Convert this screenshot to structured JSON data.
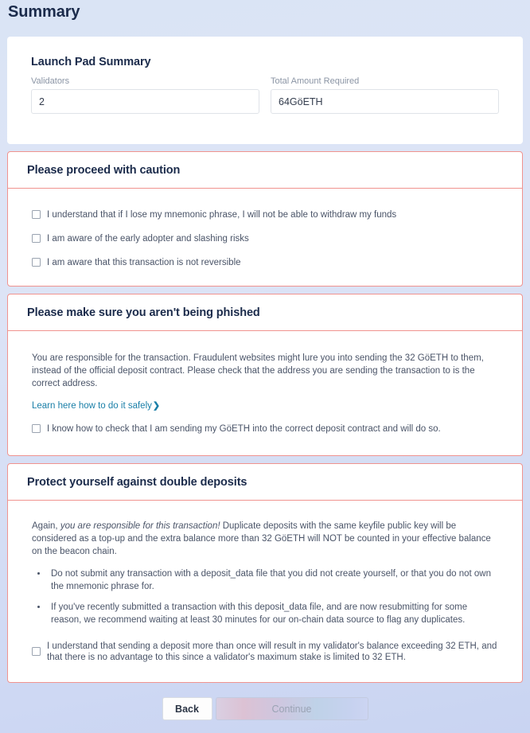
{
  "page": {
    "title": "Summary"
  },
  "summary": {
    "heading": "Launch Pad Summary",
    "validators": {
      "label": "Validators",
      "value": "2"
    },
    "total_amount": {
      "label": "Total Amount Required",
      "value": "64GöETH"
    }
  },
  "caution": {
    "title": "Please proceed with caution",
    "checkboxes": [
      {
        "label": "I understand that if I lose my mnemonic phrase, I will not be able to withdraw my funds",
        "checked": false
      },
      {
        "label": "I am aware of the early adopter and slashing risks",
        "checked": false
      },
      {
        "label": "I am aware that this transaction is not reversible",
        "checked": false
      }
    ]
  },
  "phishing": {
    "title": "Please make sure you aren't being phished",
    "paragraph": "You are responsible for the transaction. Fraudulent websites might lure you into sending the 32 GöETH to them, instead of the official deposit contract. Please check that the address you are sending the transaction to is the correct address.",
    "link_label": "Learn here how to do it safely",
    "link_chevron": "❯",
    "checkbox": {
      "label": "I know how to check that I am sending my GöETH into the correct deposit contract and will do so.",
      "checked": false
    }
  },
  "double_deposits": {
    "title": "Protect yourself against double deposits",
    "paragraph_prefix": "Again, ",
    "paragraph_italic": "you are responsible for this transaction!",
    "paragraph_suffix": " Duplicate deposits with the same keyfile public key will be considered as a top-up and the extra balance more than 32 GöETH will NOT be counted in your effective balance on the beacon chain.",
    "bullets": [
      "Do not submit any transaction with a deposit_data file that you did not create yourself, or that you do not own the mnemonic phrase for.",
      "If you've recently submitted a transaction with this deposit_data file, and are now resubmitting for some reason, we recommend waiting at least 30 minutes for our on-chain data source to flag any duplicates."
    ],
    "checkbox": {
      "label": "I understand that sending a deposit more than once will result in my validator's balance exceeding 32 ETH, and that there is no advantage to this since a validator's maximum stake is limited to 32 ETH.",
      "checked": false
    }
  },
  "footer": {
    "back_label": "Back",
    "continue_label": "Continue"
  },
  "colors": {
    "warning_border": "#f0938f",
    "link": "#1a7fa8",
    "heading": "#1b2b4b",
    "body_text": "#4a5468",
    "page_background_top": "#dae4f5",
    "page_background_bottom": "#c9d4f2"
  }
}
